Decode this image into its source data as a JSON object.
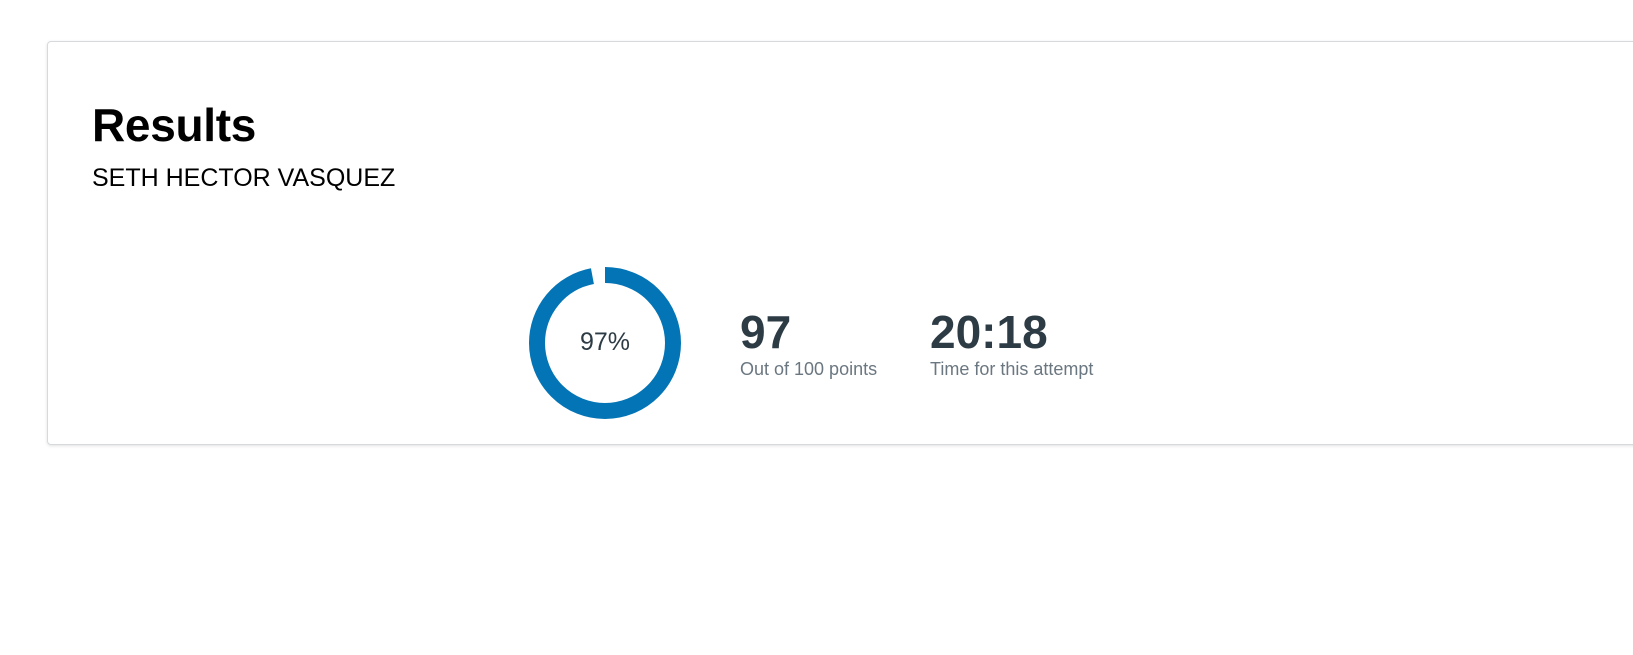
{
  "results": {
    "title": "Results",
    "student_name": "SETH HECTOR VASQUEZ",
    "score_percent_label": "97%",
    "score_fraction": 0.97,
    "score_value": "97",
    "score_caption": "Out of 100 points",
    "time_value": "20:18",
    "time_caption": "Time for this attempt"
  },
  "colors": {
    "accent": "#0374b5",
    "text_dark": "#2d3b45",
    "text_muted": "#6b7780"
  }
}
